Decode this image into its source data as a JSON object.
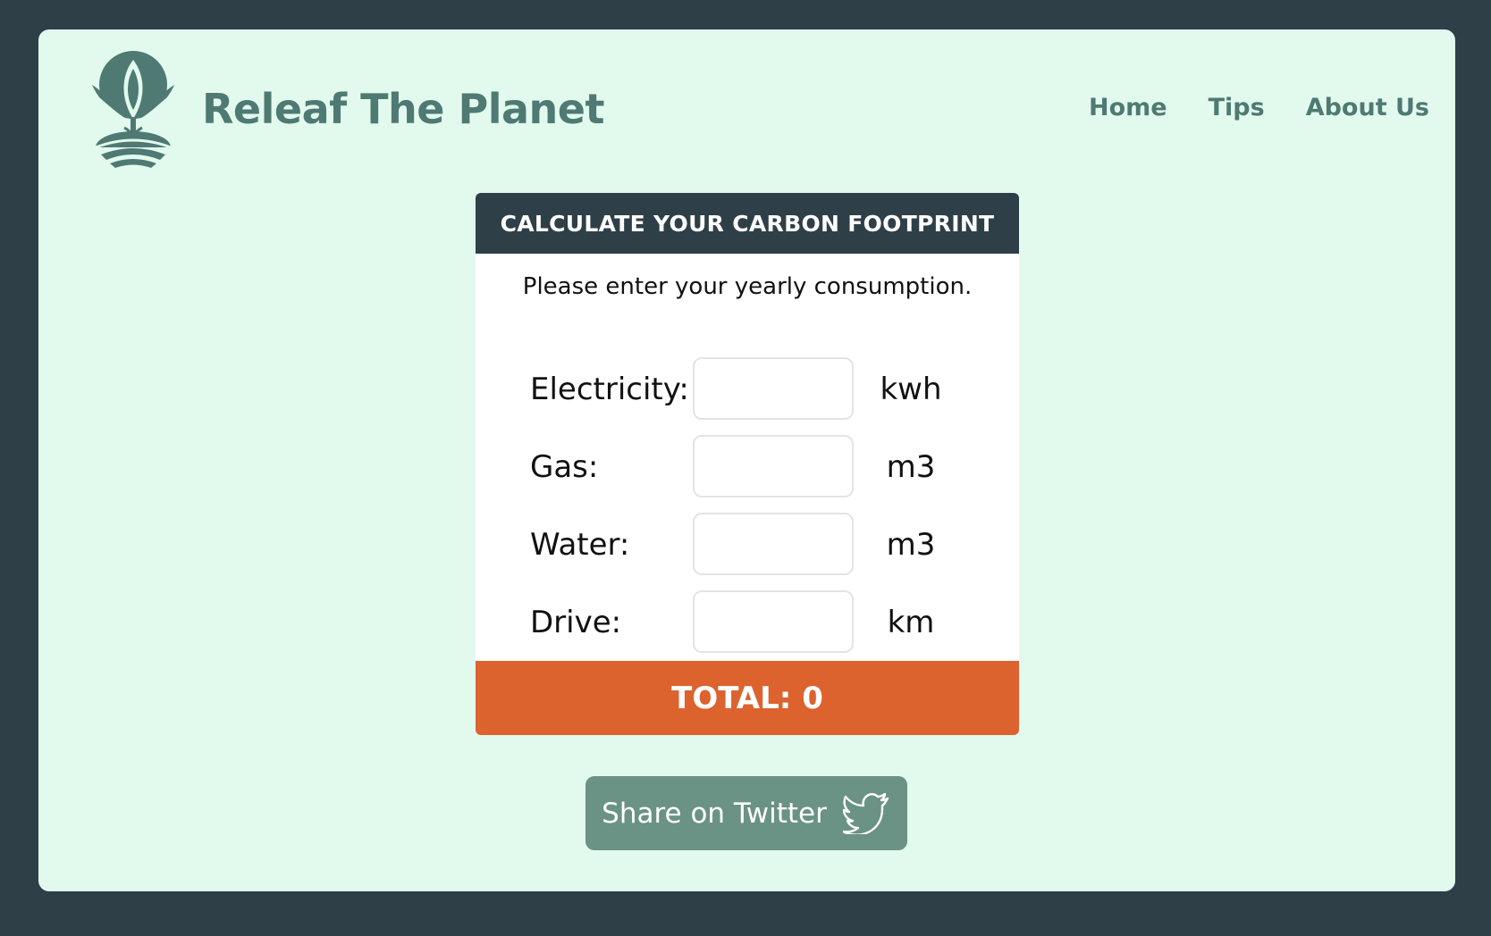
{
  "colors": {
    "background": "#2f3f47",
    "frame": "#e2faee",
    "brand": "#4f7a73",
    "card_header": "#2f3f47",
    "total": "#dc622e",
    "share_button": "#6a9285"
  },
  "brand": {
    "name": "Releaf The Planet",
    "logo_icon": "plant-leaf-logo"
  },
  "nav": {
    "items": [
      {
        "label": "Home"
      },
      {
        "label": "Tips"
      },
      {
        "label": "About Us"
      }
    ]
  },
  "calculator": {
    "title": "CALCULATE YOUR CARBON FOOTPRINT",
    "instructions": "Please enter your yearly consumption.",
    "fields": [
      {
        "label": "Electricity:",
        "unit": "kwh",
        "value": ""
      },
      {
        "label": "Gas:",
        "unit": "m3",
        "value": ""
      },
      {
        "label": "Water:",
        "unit": "m3",
        "value": ""
      },
      {
        "label": "Drive:",
        "unit": "km",
        "value": ""
      }
    ],
    "total_label": "TOTAL: 0"
  },
  "share": {
    "label": "Share on Twitter",
    "icon": "twitter-bird-icon"
  }
}
